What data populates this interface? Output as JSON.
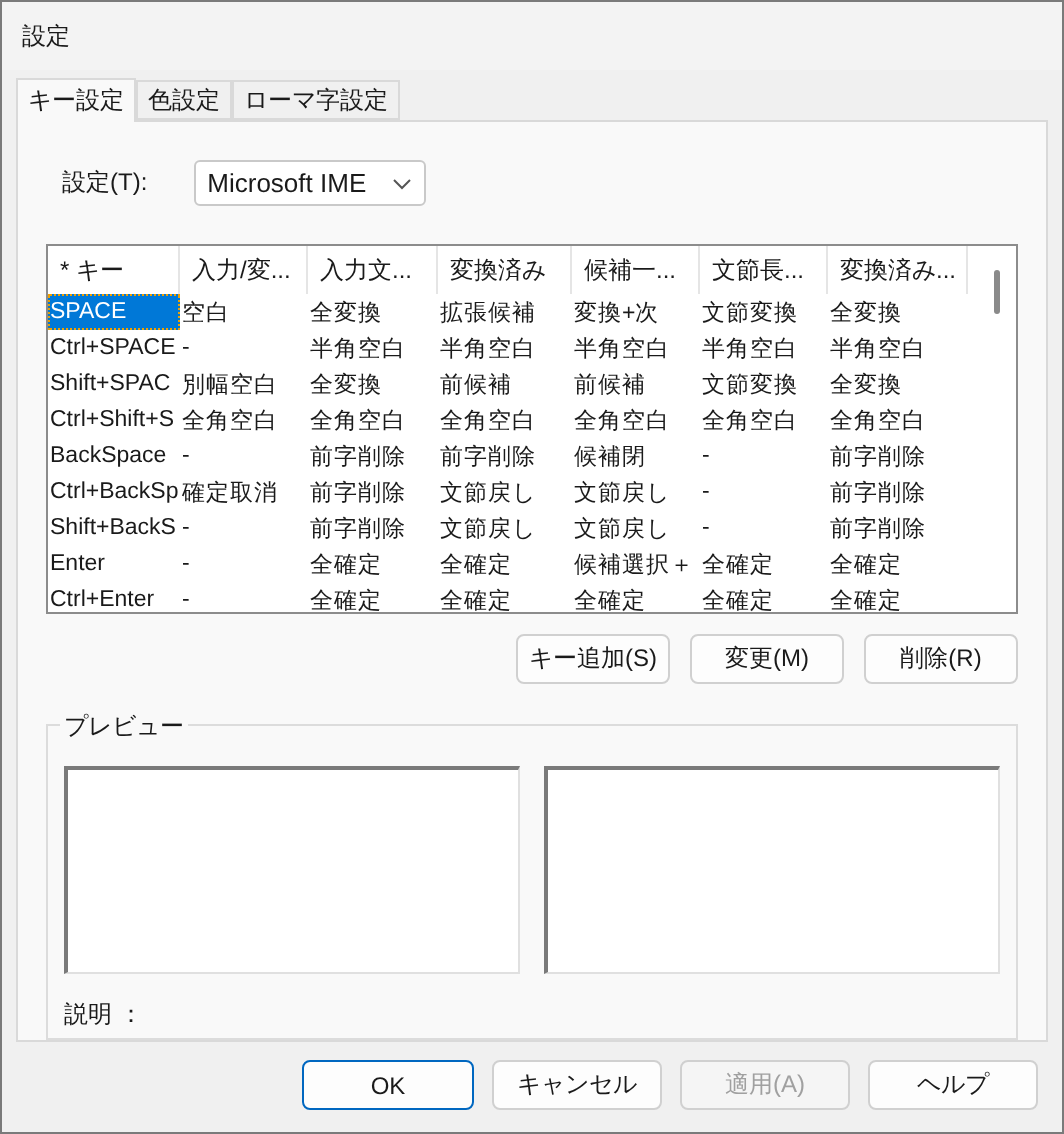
{
  "window": {
    "title": "設定"
  },
  "tabs": [
    {
      "label": "キー設定",
      "selected": true
    },
    {
      "label": "色設定",
      "selected": false
    },
    {
      "label": "ローマ字設定",
      "selected": false
    }
  ],
  "setting": {
    "label": "設定(T):",
    "value": "Microsoft IME"
  },
  "table": {
    "columns": [
      "* キー",
      "入力/変...",
      "入力文...",
      "変換済み",
      "候補一...",
      "文節長...",
      "変換済み..."
    ],
    "rows": [
      {
        "selected": true,
        "cells": [
          "SPACE",
          "空白",
          "全変換",
          "拡張候補",
          "変換+次",
          "文節変換",
          "全変換"
        ]
      },
      {
        "selected": false,
        "cells": [
          "Ctrl+SPACE",
          "-",
          "半角空白",
          "半角空白",
          "半角空白",
          "半角空白",
          "半角空白"
        ]
      },
      {
        "selected": false,
        "cells": [
          "Shift+SPAC",
          "別幅空白",
          "全変換",
          "前候補",
          "前候補",
          "文節変換",
          "全変換"
        ]
      },
      {
        "selected": false,
        "cells": [
          "Ctrl+Shift+S",
          "全角空白",
          "全角空白",
          "全角空白",
          "全角空白",
          "全角空白",
          "全角空白"
        ]
      },
      {
        "selected": false,
        "cells": [
          "BackSpace",
          "-",
          "前字削除",
          "前字削除",
          "候補閉",
          "-",
          "前字削除"
        ]
      },
      {
        "selected": false,
        "cells": [
          "Ctrl+BackSp",
          "確定取消",
          "前字削除",
          "文節戻し",
          "文節戻し",
          "-",
          "前字削除"
        ]
      },
      {
        "selected": false,
        "cells": [
          "Shift+BackS",
          "-",
          "前字削除",
          "文節戻し",
          "文節戻し",
          "-",
          "前字削除"
        ]
      },
      {
        "selected": false,
        "cells": [
          "Enter",
          "-",
          "全確定",
          "全確定",
          "候補選択＋",
          "全確定",
          "全確定"
        ]
      },
      {
        "selected": false,
        "cells": [
          "Ctrl+Enter",
          "-",
          "全確定",
          "全確定",
          "全確定",
          "全確定",
          "全確定"
        ]
      }
    ]
  },
  "table_buttons": [
    "キー追加(S)",
    "変更(M)",
    "削除(R)"
  ],
  "preview": {
    "title": "プレビュー",
    "description_label": "説明 ："
  },
  "buttons": [
    {
      "label": "OK",
      "kind": "default",
      "disabled": false
    },
    {
      "label": "キャンセル",
      "kind": "normal",
      "disabled": false
    },
    {
      "label": "適用(A)",
      "kind": "normal",
      "disabled": true
    },
    {
      "label": "ヘルプ",
      "kind": "normal",
      "disabled": false
    }
  ]
}
